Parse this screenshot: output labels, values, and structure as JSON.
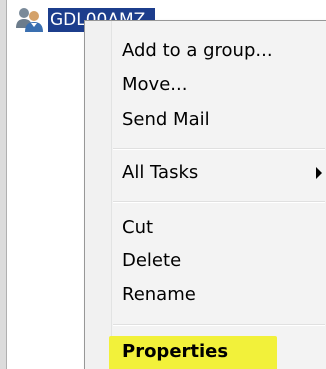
{
  "tree": {
    "selected_item_label": "GDL00AMZ",
    "icon": "group-users-icon"
  },
  "context_menu": {
    "items": [
      {
        "label": "Add to a group..."
      },
      {
        "label": "Move..."
      },
      {
        "label": "Send Mail"
      },
      {
        "label": "All Tasks",
        "has_submenu": true
      },
      {
        "label": "Cut"
      },
      {
        "label": "Delete"
      },
      {
        "label": "Rename"
      },
      {
        "label": "Properties",
        "bold": true,
        "highlighted": true
      }
    ]
  },
  "colors": {
    "selection_background": "#1c3d8c",
    "menu_background": "#f3f3f3",
    "highlight": "#f2f13a"
  }
}
